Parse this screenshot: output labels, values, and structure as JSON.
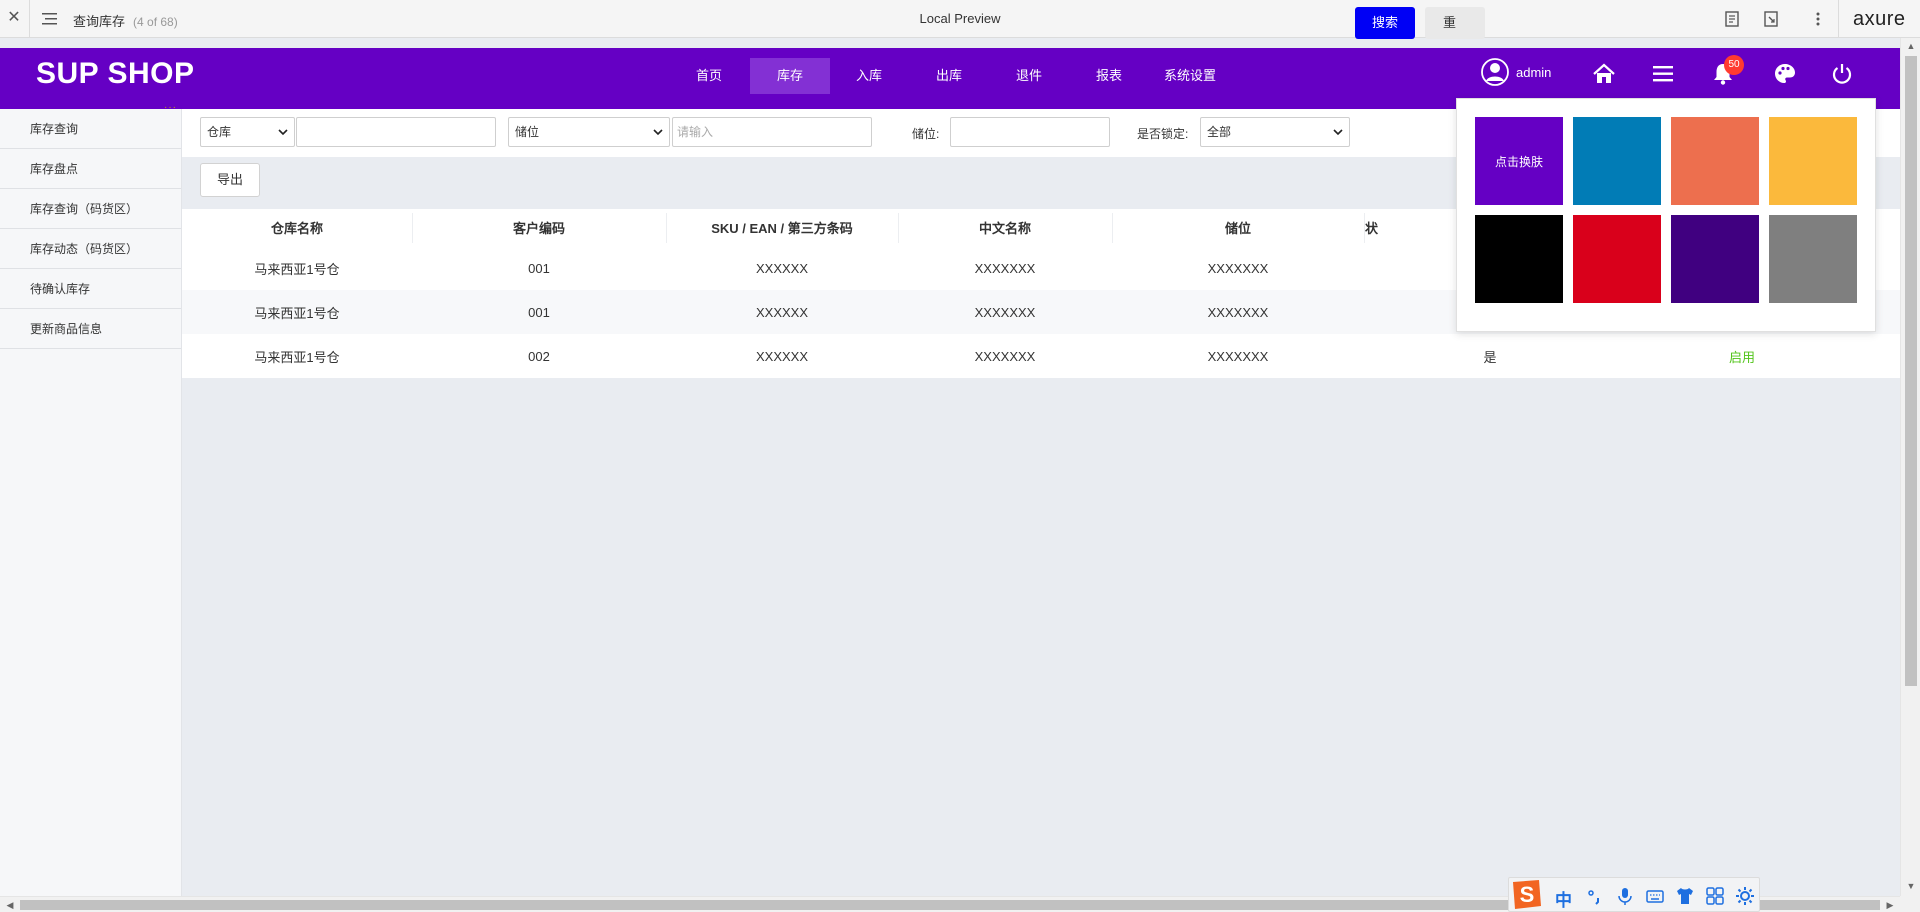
{
  "preview": {
    "page_title": "查询库存",
    "page_count": "(4 of 68)",
    "center_title": "Local Preview",
    "brand": "axure"
  },
  "app": {
    "logo": "SUP SHOP",
    "nav": [
      {
        "label": "首页"
      },
      {
        "label": "库存"
      },
      {
        "label": "入库"
      },
      {
        "label": "出库"
      },
      {
        "label": "退件"
      },
      {
        "label": "报表"
      },
      {
        "label": "系统设置"
      }
    ],
    "active_nav": "库存",
    "user": "admin",
    "notification_count": "50",
    "accent_color": "#6500c4"
  },
  "sidebar": {
    "items": [
      {
        "label": "库存查询"
      },
      {
        "label": "库存盘点"
      },
      {
        "label": "库存查询（码货区）"
      },
      {
        "label": "库存动态（码货区）"
      },
      {
        "label": "待确认库存"
      },
      {
        "label": "更新商品信息"
      }
    ]
  },
  "filters": {
    "warehouse_select": "仓库",
    "warehouse_input": "",
    "location_select": "储位",
    "location_input_placeholder": "请输入",
    "location_label": "储位:",
    "location_value": "",
    "locked_label": "是否锁定:",
    "locked_select": "全部",
    "search_button": "搜索",
    "reset_button": "重"
  },
  "toolbar": {
    "export_button": "导出"
  },
  "table": {
    "headers": [
      "仓库名称",
      "客户编码",
      "SKU / EAN / 第三方条码",
      "中文名称",
      "储位",
      "状"
    ],
    "rows": [
      {
        "warehouse": "马来西亚1号仓",
        "customer": "001",
        "sku": "XXXXXX",
        "name_cn": "XXXXXXX",
        "location": "XXXXXXX",
        "locked": "",
        "status": ""
      },
      {
        "warehouse": "马来西亚1号仓",
        "customer": "001",
        "sku": "XXXXXX",
        "name_cn": "XXXXXXX",
        "location": "XXXXXXX",
        "locked": "",
        "status": ""
      },
      {
        "warehouse": "马来西亚1号仓",
        "customer": "002",
        "sku": "XXXXXX",
        "name_cn": "XXXXXXX",
        "location": "XXXXXXX",
        "locked": "是",
        "status": "启用"
      }
    ]
  },
  "skin_popup": {
    "swatches": [
      {
        "label": "点击换肤",
        "color": "#6500c4"
      },
      {
        "label": "",
        "color": "#017cb6"
      },
      {
        "label": "",
        "color": "#ed6f4e"
      },
      {
        "label": "",
        "color": "#fbb93c"
      },
      {
        "label": "",
        "color": "#000000"
      },
      {
        "label": "",
        "color": "#d9001b"
      },
      {
        "label": "",
        "color": "#400080"
      },
      {
        "label": "",
        "color": "#7f7f7f"
      }
    ]
  },
  "ime": {
    "mode": "中"
  }
}
